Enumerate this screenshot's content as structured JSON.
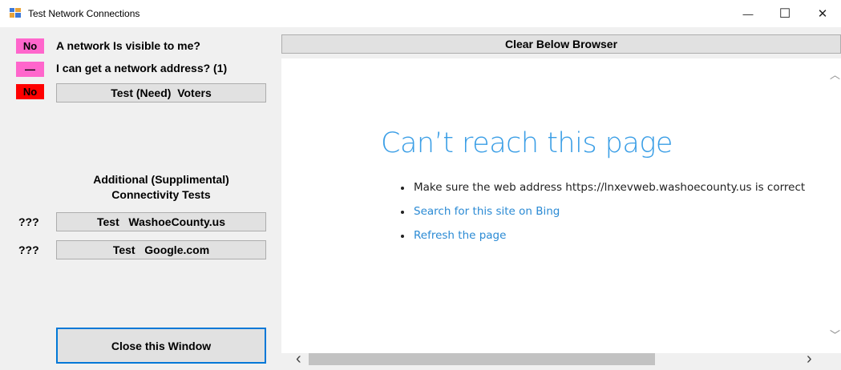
{
  "window": {
    "title": "Test Network Connections",
    "minimize_glyph": "—",
    "maximize_glyph": "☐",
    "close_glyph": "✕"
  },
  "status": {
    "network_visible": {
      "value": "No",
      "label": "A network Is visible to me?",
      "color": "#ff66cc"
    },
    "network_address": {
      "value": "—",
      "label": "I can get a network address? (1)",
      "color": "#ff66cc"
    },
    "voters": {
      "value": "No",
      "color": "#ff0000",
      "button_label": "Test (Need)  Voters"
    }
  },
  "supplemental": {
    "heading_line1": "Additional (Supplimental)",
    "heading_line2": "Connectivity Tests",
    "washoe": {
      "result": "???",
      "button_label": "Test   WashoeCounty.us"
    },
    "google": {
      "result": "???",
      "button_label": "Test   Google.com"
    }
  },
  "close_button_label": "Close this Window",
  "clear_button_label": "Clear Below Browser",
  "browser": {
    "heading": "Can’t reach this page",
    "bullets": {
      "address": "Make sure the web address https://lnxevweb.washoecounty.us is correct",
      "search": "Search for this site on Bing",
      "refresh": "Refresh the page"
    },
    "scroll_up_glyph": "︿",
    "scroll_down_glyph": "﹀",
    "scroll_left_glyph": "‹",
    "scroll_right_glyph": "›"
  },
  "colors": {
    "link": "#2a8ad4",
    "heading": "#3a9ee6",
    "focus_border": "#0078d7"
  }
}
